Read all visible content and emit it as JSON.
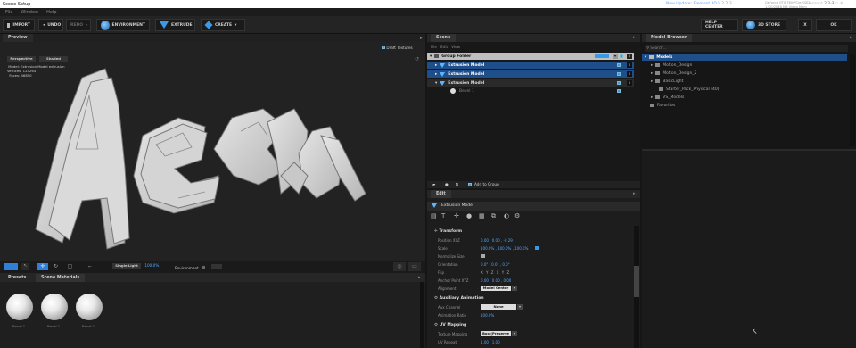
{
  "app": {
    "title": "Scene Setup"
  },
  "menu": [
    "File",
    "Window",
    "Help"
  ],
  "topright": {
    "update": "New Update: Element 3D V.2.2.3",
    "gpu_line1": "GeForce GTX 760/PCIe/SSE2",
    "gpu_line2": "1.0G/2048 MB Video Mem",
    "element": "Element",
    "version": "2.2.3"
  },
  "toolbar": {
    "import": "IMPORT",
    "undo": "UNDO",
    "redo": "REDO",
    "environment": "ENVIRONMENT",
    "extrude": "EXTRUDE",
    "create": "CREATE",
    "help": "HELP CENTER",
    "store": "3D STORE",
    "close": "X",
    "ok": "OK"
  },
  "preview": {
    "tab": "Preview",
    "draft_textures": "Draft Textures",
    "camera": "Perspective",
    "shading": "Shaded",
    "info_model_label": "Model:",
    "info_model": "Extrusion Model extrusion",
    "info_vertices_label": "Vertices:",
    "info_vertices": "124264",
    "info_faces_label": "Faces:",
    "info_faces": "46890",
    "light_mode": "Single Light",
    "light_value": "100.0%",
    "environment_label": "Environment"
  },
  "presets": {
    "tab1": "Presets",
    "tab2": "Scene Materials",
    "items": [
      "Bevel 1",
      "Bevel 1",
      "Bevel 1"
    ]
  },
  "scene": {
    "tab": "Scene",
    "menu": [
      "File",
      "Edit",
      "View"
    ],
    "group": "Group Folder",
    "items": [
      "Extrusion Model",
      "Extrusion Model",
      "Extrusion Model"
    ],
    "bevel": "Bevel 1",
    "add_to_group": "Add to Group"
  },
  "edit": {
    "tab": "Edit",
    "header": "Extrusion Model",
    "transform_title": "Transform",
    "fields": [
      {
        "label": "Position XYZ",
        "value": "0.00 , 0.00 , -0.29"
      },
      {
        "label": "Scale",
        "value": "100.0% , 100.0% , 100.0%"
      },
      {
        "label": "Normalize Size",
        "value": ""
      },
      {
        "label": "Orientation",
        "value": "0.0° , 0.0° , 0.0°"
      },
      {
        "label": "Flip",
        "value": "X  Y  Z  X  Y  Z"
      },
      {
        "label": "Anchor Point XYZ",
        "value": "0.00 , 0.00 , 0.00"
      },
      {
        "label": "Alignment",
        "value": "Model Center"
      }
    ],
    "aux_title": "Auxiliary Animation",
    "aux_fields": [
      {
        "label": "Aux Channel",
        "value": "None"
      },
      {
        "label": "Animation Ratio",
        "value": "100.0%"
      }
    ],
    "uv_title": "UV Mapping",
    "uv_fields": [
      {
        "label": "Texture Mapping",
        "value": "Box (Preserve"
      },
      {
        "label": "UV Repeat",
        "value": "1.00 , 1.00"
      }
    ]
  },
  "browser": {
    "tab": "Model Browser",
    "search_placeholder": "Search...",
    "root": "Models",
    "items": [
      "Motion_Design",
      "Motion_Design_2",
      "BasicLight",
      "Starter_Pack_Physical (40)",
      "VS_Models"
    ],
    "favorites": "Favorites"
  }
}
